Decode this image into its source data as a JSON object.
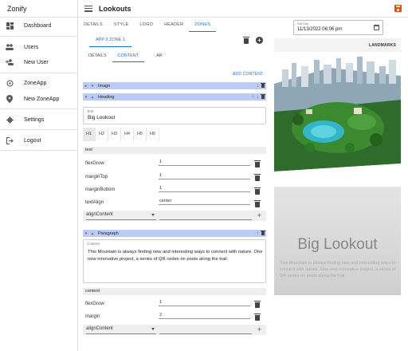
{
  "app": {
    "title": "Zonify"
  },
  "sidebar": {
    "items": [
      {
        "label": "Dashboard",
        "icon": "dashboard-icon"
      },
      {
        "label": "Users",
        "icon": "users-icon"
      },
      {
        "label": "New User",
        "icon": "add-user-icon"
      },
      {
        "label": "ZoneApp",
        "icon": "zone-icon"
      },
      {
        "label": "New ZoneApp",
        "icon": "add-zone-icon"
      },
      {
        "label": "Settings",
        "icon": "gear-icon"
      },
      {
        "label": "Logout",
        "icon": "logout-icon"
      }
    ]
  },
  "header": {
    "title": "Lookouts"
  },
  "tabs": [
    "DETAILS",
    "STYLE",
    "LOGO",
    "HEADER",
    "ZONES"
  ],
  "zone": {
    "tab_label": "APP 2 ZONE 1"
  },
  "subtabs": [
    "DETAILS",
    "CONTENT",
    "AR"
  ],
  "add_content": "ADD CONTENT",
  "blocks": {
    "image": {
      "label": "Image"
    },
    "heading": {
      "label": "Heading",
      "field_label": "Text",
      "field_value": "Big Lookout",
      "levels": [
        "H1",
        "H2",
        "H3",
        "H4",
        "H5",
        "H6"
      ],
      "section": "text",
      "props": [
        {
          "label": "flexGrow",
          "value": "1"
        },
        {
          "label": "marginTop",
          "value": "1"
        },
        {
          "label": "marginBottom",
          "value": "1"
        },
        {
          "label": "textAlign",
          "value": "center"
        }
      ],
      "add_select": "alignContent"
    },
    "paragraph": {
      "label": "Paragraph",
      "field_label": "Content",
      "field_value": "This Mountain is always finding new and interesting ways to connect with nature. One new innovative project, a series of QR codes on posts along the trail.",
      "section": "content",
      "props": [
        {
          "label": "flexGrow",
          "value": "1"
        },
        {
          "label": "margin",
          "value": "2"
        }
      ],
      "add_select": "alignContent"
    }
  },
  "setday": {
    "label": "Set Day",
    "value": "11/13/2022 06:06 pm"
  },
  "preview": {
    "banner": "LANDMARKS",
    "title": "Big Lookout",
    "body": "This Mountain is always finding new and interesting ways to connect with nature. One new innovative project, a series of QR codes on posts along the trail."
  },
  "colors": {
    "accent": "#1976d2",
    "block_header": "#bccbf5",
    "save": "#e65100"
  }
}
